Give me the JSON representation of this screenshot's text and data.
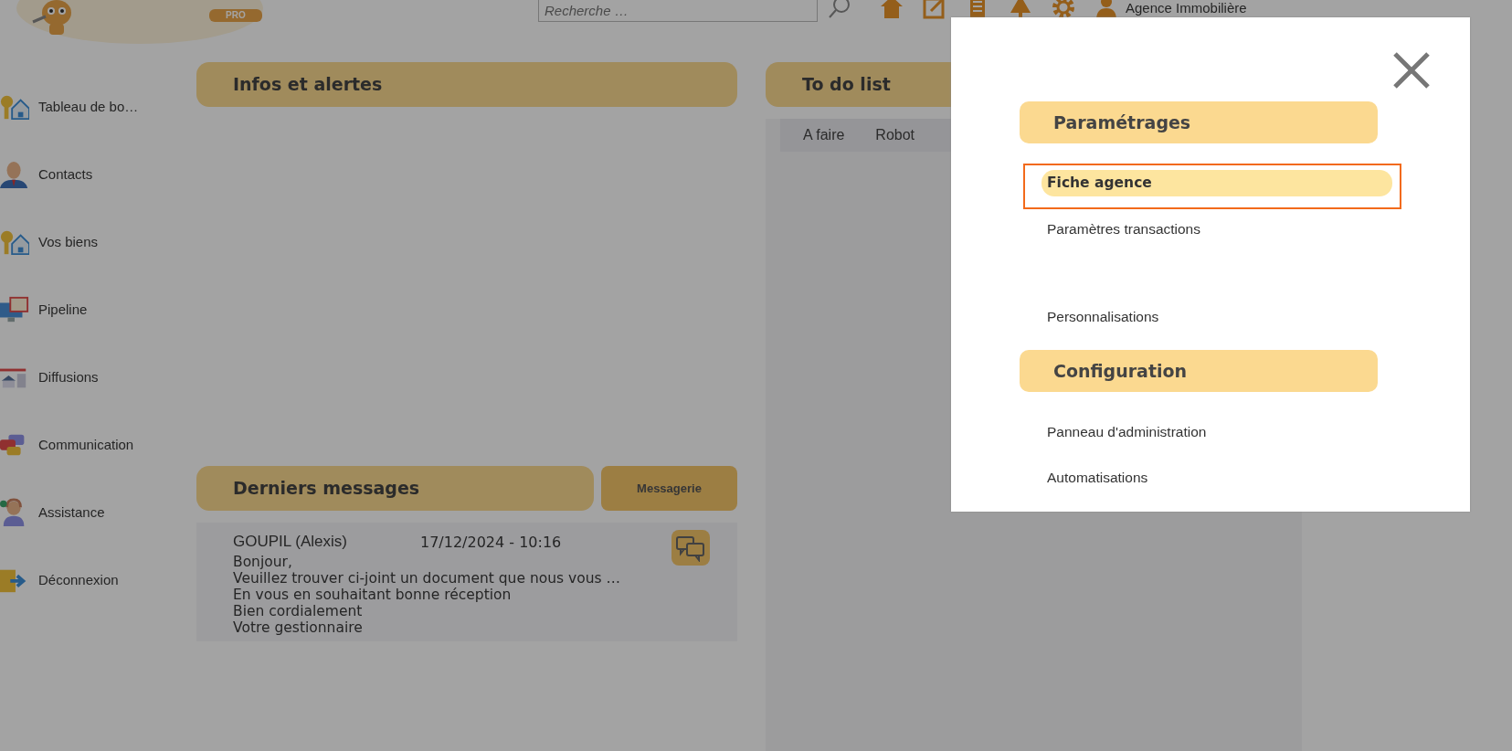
{
  "header": {
    "logo_badge": "PRO",
    "search": {
      "placeholder": "Recherche …"
    },
    "toolbar": [
      {
        "kind": "home"
      },
      {
        "kind": "edit"
      },
      {
        "kind": "document"
      },
      {
        "kind": "tree"
      },
      {
        "kind": "gear"
      },
      {
        "kind": "person"
      }
    ],
    "account": "Agence Immobilière"
  },
  "sidebar": {
    "items": [
      {
        "label": "Tableau de bo…",
        "kind": "keys-house"
      },
      {
        "label": "Contacts",
        "kind": "person"
      },
      {
        "label": "Vos biens",
        "kind": "keys-house"
      },
      {
        "label": "Pipeline",
        "kind": "monitor"
      },
      {
        "label": "Diffusions",
        "kind": "billboard"
      },
      {
        "label": "Communication",
        "kind": "chat"
      },
      {
        "label": "Assistance",
        "kind": "headset"
      },
      {
        "label": "Déconnexion",
        "kind": "exit"
      }
    ]
  },
  "infos": {
    "title": "Infos et alertes"
  },
  "todo": {
    "title": "To do list",
    "tabs": [
      {
        "label": "A faire",
        "selected": false
      },
      {
        "label": "Robot",
        "selected": false
      }
    ]
  },
  "messages": {
    "title": "Derniers messages",
    "button": "Messagerie",
    "items": [
      {
        "sender": "GOUPIL (Alexis)",
        "date": "17/12/2024 - 10:16",
        "lines": [
          "Bonjour,",
          "Veuillez trouver ci-joint un document que nous vous …",
          "En vous en souhaitant bonne réception",
          "Bien cordialement",
          "Votre gestionnaire"
        ]
      }
    ]
  },
  "modal": {
    "sections": [
      {
        "title": "Paramétrages",
        "items": [
          {
            "label": "Fiche agence",
            "selected": true,
            "outlined": true
          },
          {
            "label": "Paramètres transactions",
            "selected": false,
            "outlined": false
          },
          {
            "label": "Personnalisations",
            "selected": false,
            "outlined": false
          }
        ]
      },
      {
        "title": "Configuration",
        "items": [
          {
            "label": "Panneau d'administration",
            "selected": false,
            "outlined": false
          },
          {
            "label": "Automatisations",
            "selected": false,
            "outlined": false
          }
        ]
      }
    ]
  }
}
